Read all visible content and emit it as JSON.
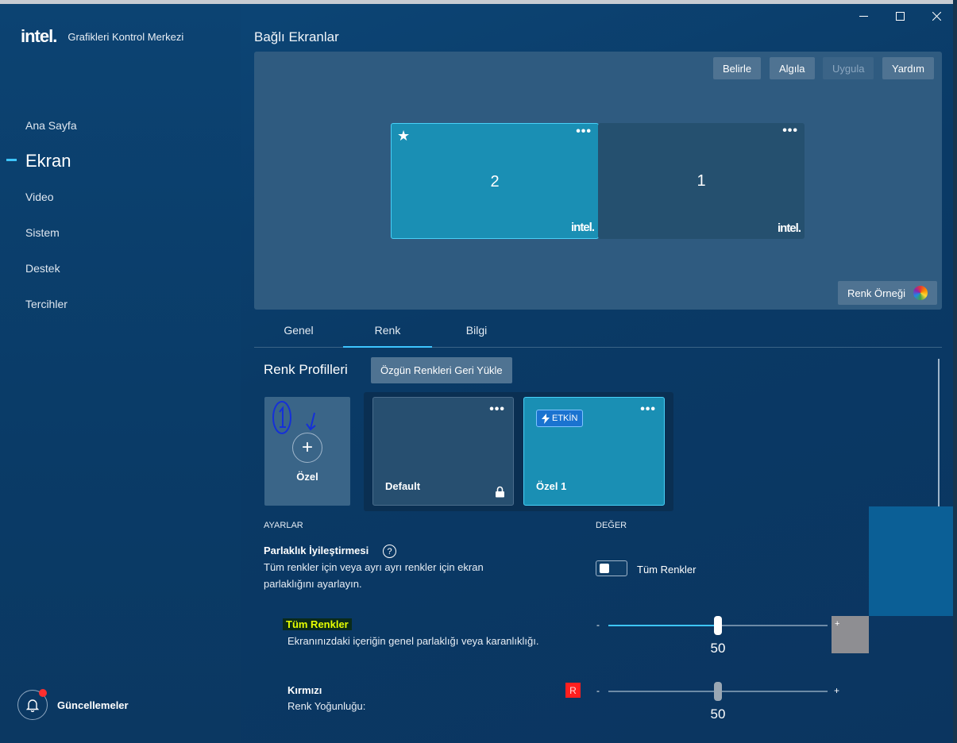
{
  "app": {
    "logo_text": "intel.",
    "title": "Grafikleri Kontrol Merkezi"
  },
  "window_controls": {
    "minimize": "—",
    "maximize": "☐",
    "close": "✕"
  },
  "sidebar": {
    "items": [
      {
        "label": "Ana Sayfa",
        "active": false
      },
      {
        "label": "Ekran",
        "active": true
      },
      {
        "label": "Video",
        "active": false
      },
      {
        "label": "Sistem",
        "active": false
      },
      {
        "label": "Destek",
        "active": false
      },
      {
        "label": "Tercihler",
        "active": false
      }
    ],
    "updates_label": "Güncellemeler"
  },
  "connected": {
    "title": "Bağlı Ekranlar",
    "buttons": {
      "identify": "Belirle",
      "detect": "Algıla",
      "apply": "Uygula",
      "help": "Yardım"
    },
    "monitors": [
      {
        "number": "2",
        "primary": true,
        "dots": "•••",
        "logo": "intel."
      },
      {
        "number": "1",
        "primary": false,
        "dots": "•••",
        "logo": "intel."
      }
    ],
    "color_sample": "Renk Örneği"
  },
  "tabs": [
    {
      "label": "Genel"
    },
    {
      "label": "Renk"
    },
    {
      "label": "Bilgi"
    }
  ],
  "profiles": {
    "title": "Renk Profilleri",
    "restore_button": "Özgün Renkleri Geri Yükle",
    "add_label": "Özel",
    "cards": [
      {
        "name": "Default",
        "dots": "•••",
        "locked": true
      },
      {
        "name": "Özel 1",
        "dots": "•••",
        "badge": "ETKİN"
      }
    ]
  },
  "settings": {
    "col_settings": "AYARLAR",
    "col_value": "DEĞER",
    "brightness": {
      "title": "Parlaklık İyileştirmesi",
      "help": "?",
      "desc_line1": "Tüm renkler için veya ayrı ayrı renkler için ekran",
      "desc_line2": "parlaklığını ayarlayın.",
      "toggle_label": "Tüm Renkler"
    },
    "all_colors": {
      "title": "Tüm Renkler",
      "desc": "Ekranınızdaki içeriğin genel parlaklığı veya karanlıklığı.",
      "minus": "-",
      "plus": "+",
      "value": "50"
    },
    "red": {
      "title": "Kırmızı",
      "desc": "Renk Yoğunluğu:",
      "badge": "R",
      "minus": "-",
      "plus": "+",
      "value": "50"
    }
  },
  "colors": {
    "accent": "#3ec5ff",
    "card_active": "#1a8fb4",
    "badge_red": "#ff1f1f"
  }
}
